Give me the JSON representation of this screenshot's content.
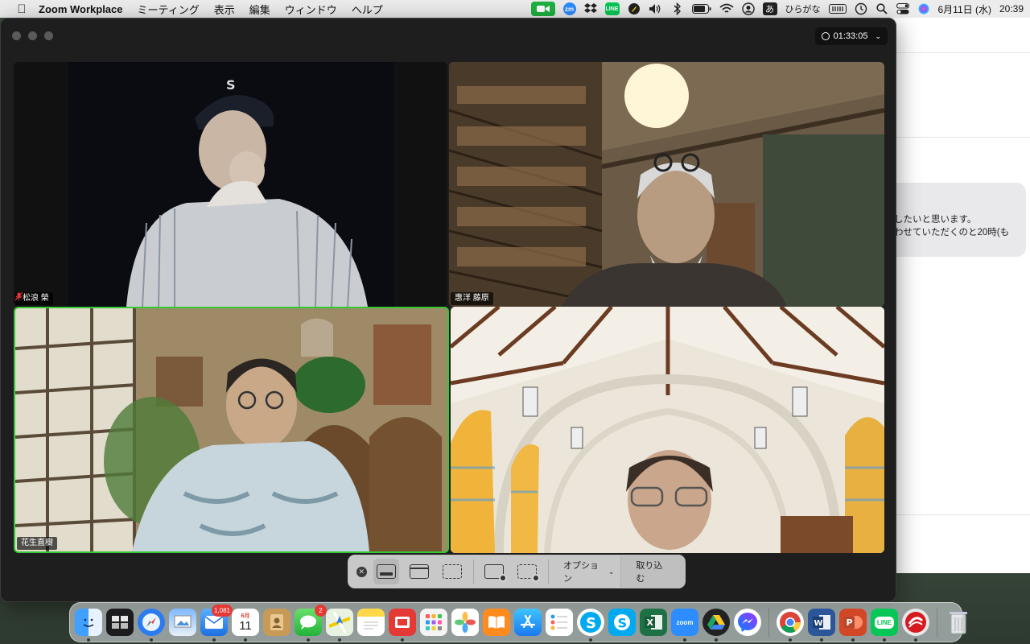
{
  "menubar": {
    "apple_icon": "apple-logo",
    "app_name": "Zoom Workplace",
    "menus": [
      "ミーティング",
      "表示",
      "編集",
      "ウィンドウ",
      "ヘルプ"
    ],
    "ime_label": "あ",
    "ime_mode": "ひらがな",
    "date": "6月11日 (水)",
    "time": "20:39"
  },
  "background_window": {
    "message_line1": "したいと思います。",
    "message_line2": "わせていただくのと20時(も"
  },
  "zoom": {
    "meeting_timer": "01:33:05",
    "participants": [
      {
        "name": "松浪 榮",
        "muted": true,
        "active_speaker": false
      },
      {
        "name": "惠洋 藤原",
        "muted": false,
        "active_speaker": false
      },
      {
        "name": "花生直樹",
        "muted": false,
        "active_speaker": true
      },
      {
        "name": "",
        "muted": false,
        "active_speaker": false
      }
    ],
    "active_speaker_color": "#37c837"
  },
  "capture_toolbar": {
    "options_label": "オプション",
    "capture_label": "取り込む"
  },
  "dock": {
    "mail_badge": "1,081",
    "messages_badge": "2",
    "calendar_month": "6月",
    "calendar_day": "11",
    "zoom_label": "zoom",
    "line_label": "LINE"
  }
}
